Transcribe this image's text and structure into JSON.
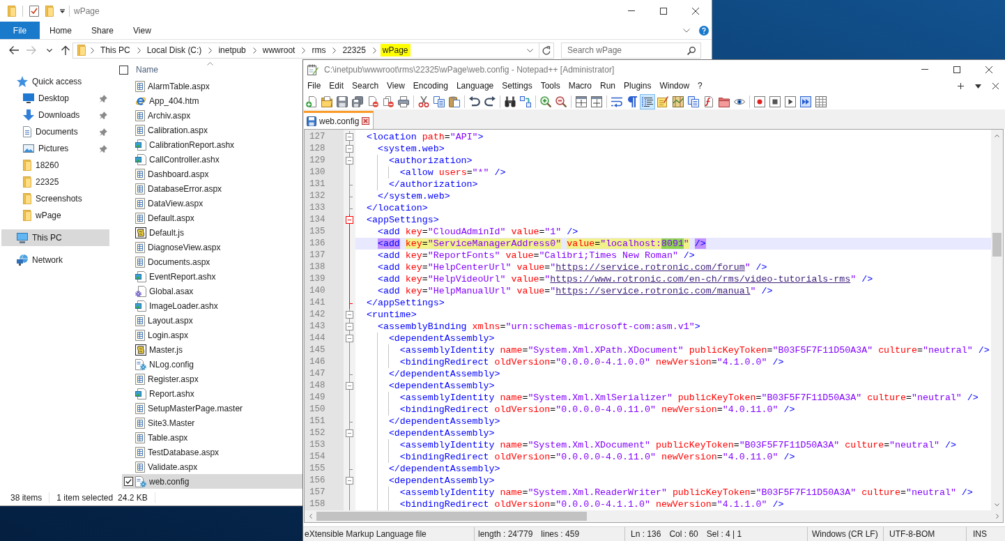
{
  "explorer": {
    "title": "wPage",
    "ribbon_tabs": [
      {
        "label": "File",
        "kind": "menu"
      },
      {
        "label": "Home",
        "kind": "tab"
      },
      {
        "label": "Share",
        "kind": "tab"
      },
      {
        "label": "View",
        "kind": "tab"
      }
    ],
    "navigation_buttons": [
      {
        "kind": "back",
        "disabled": false
      },
      {
        "kind": "forward",
        "disabled": true
      },
      {
        "kind": "recent",
        "disabled": false
      },
      {
        "kind": "up",
        "disabled": false
      }
    ],
    "breadcrumbs": [
      {
        "label": "This PC",
        "highlighted": false
      },
      {
        "label": "Local Disk (C:)",
        "highlighted": false
      },
      {
        "label": "inetpub",
        "highlighted": false
      },
      {
        "label": "wwwroot",
        "highlighted": false
      },
      {
        "label": "rms",
        "highlighted": false
      },
      {
        "label": "22325",
        "highlighted": false
      },
      {
        "label": "wPage",
        "highlighted": true
      }
    ],
    "search": {
      "placeholder": "Search wPage"
    },
    "navigation": [
      {
        "label": "Quick access",
        "kind": "star",
        "selected": false,
        "children": [
          {
            "label": "Desktop",
            "kind": "desktop",
            "selected": false,
            "pinned": true
          },
          {
            "label": "Downloads",
            "kind": "downloads",
            "selected": false,
            "pinned": true
          },
          {
            "label": "Documents",
            "kind": "documents",
            "selected": false,
            "pinned": true
          },
          {
            "label": "Pictures",
            "kind": "pictures",
            "selected": false,
            "pinned": true
          },
          {
            "label": "18260",
            "kind": "folder",
            "selected": false,
            "pinned": false
          },
          {
            "label": "22325",
            "kind": "folder",
            "selected": false,
            "pinned": false
          },
          {
            "label": "Screenshots",
            "kind": "folder",
            "selected": false,
            "pinned": false
          },
          {
            "label": "wPage",
            "kind": "folder",
            "selected": false,
            "pinned": false
          }
        ]
      },
      {
        "label": "This PC",
        "kind": "computer",
        "selected": true
      },
      {
        "label": "Network",
        "kind": "network",
        "selected": false
      }
    ],
    "select_all": {
      "checked": false
    },
    "column": {
      "label": "Name",
      "sort_ascending": true
    },
    "files": [
      {
        "name": "AlarmTable.aspx",
        "kind": "page",
        "selected": false
      },
      {
        "name": "App_404.htm",
        "kind": "web",
        "selected": false
      },
      {
        "name": "Archiv.aspx",
        "kind": "page",
        "selected": false
      },
      {
        "name": "Calibration.aspx",
        "kind": "page",
        "selected": false
      },
      {
        "name": "CalibrationReport.ashx",
        "kind": "handler",
        "selected": false
      },
      {
        "name": "CallController.ashx",
        "kind": "handler",
        "selected": false
      },
      {
        "name": "Dashboard.aspx",
        "kind": "page",
        "selected": false
      },
      {
        "name": "DatabaseError.aspx",
        "kind": "page",
        "selected": false
      },
      {
        "name": "DataView.aspx",
        "kind": "page",
        "selected": false
      },
      {
        "name": "Default.aspx",
        "kind": "page",
        "selected": false
      },
      {
        "name": "Default.js",
        "kind": "script",
        "selected": false
      },
      {
        "name": "DiagnoseView.aspx",
        "kind": "page",
        "selected": false
      },
      {
        "name": "Documents.aspx",
        "kind": "page",
        "selected": false
      },
      {
        "name": "EventReport.ashx",
        "kind": "handler",
        "selected": false
      },
      {
        "name": "Global.asax",
        "kind": "app",
        "selected": false
      },
      {
        "name": "ImageLoader.ashx",
        "kind": "handler",
        "selected": false
      },
      {
        "name": "Layout.aspx",
        "kind": "page",
        "selected": false
      },
      {
        "name": "Login.aspx",
        "kind": "page",
        "selected": false
      },
      {
        "name": "Master.js",
        "kind": "script",
        "selected": false
      },
      {
        "name": "NLog.config",
        "kind": "config",
        "selected": false
      },
      {
        "name": "Register.aspx",
        "kind": "page",
        "selected": false
      },
      {
        "name": "Report.ashx",
        "kind": "handler",
        "selected": false
      },
      {
        "name": "SetupMasterPage.master",
        "kind": "page",
        "selected": false
      },
      {
        "name": "Site3.Master",
        "kind": "page",
        "selected": false
      },
      {
        "name": "Table.aspx",
        "kind": "page",
        "selected": false
      },
      {
        "name": "TestDatabase.aspx",
        "kind": "page",
        "selected": false
      },
      {
        "name": "Validate.aspx",
        "kind": "page",
        "selected": false
      },
      {
        "name": "web.config",
        "kind": "config",
        "selected": true
      }
    ],
    "status": {
      "count": "38 items",
      "selection": "1 item selected",
      "size": "24.2 KB"
    }
  },
  "notepad": {
    "title": "C:\\inetpub\\wwwroot\\rms\\22325\\wPage\\web.config - Notepad++ [Administrator]",
    "menu": [
      "File",
      "Edit",
      "Search",
      "View",
      "Encoding",
      "Language",
      "Settings",
      "Tools",
      "Macro",
      "Run",
      "Plugins",
      "Window",
      "?"
    ],
    "toolbar": [
      [
        {
          "kind": "new",
          "pressed": false
        },
        {
          "kind": "open",
          "pressed": false
        },
        {
          "kind": "save",
          "pressed": false
        },
        {
          "kind": "saveall",
          "pressed": false
        },
        {
          "kind": "close",
          "pressed": false
        },
        {
          "kind": "closeall",
          "pressed": false
        },
        {
          "kind": "print",
          "pressed": false
        }
      ],
      [
        {
          "kind": "cut",
          "pressed": false
        },
        {
          "kind": "copy",
          "pressed": false
        },
        {
          "kind": "paste",
          "pressed": false
        }
      ],
      [
        {
          "kind": "undo",
          "pressed": false
        },
        {
          "kind": "redo",
          "pressed": false
        }
      ],
      [
        {
          "kind": "find",
          "pressed": false
        },
        {
          "kind": "replace",
          "pressed": false
        }
      ],
      [
        {
          "kind": "zoomin",
          "pressed": false
        },
        {
          "kind": "zoomout",
          "pressed": false
        }
      ],
      [
        {
          "kind": "syncv",
          "pressed": false
        },
        {
          "kind": "synch",
          "pressed": false
        }
      ],
      [
        {
          "kind": "wrap",
          "pressed": false
        },
        {
          "kind": "pilcrow",
          "pressed": false
        },
        {
          "kind": "indent",
          "pressed": true
        },
        {
          "kind": "note",
          "pressed": false
        },
        {
          "kind": "map",
          "pressed": false
        },
        {
          "kind": "doclist",
          "pressed": false
        },
        {
          "kind": "function",
          "pressed": false
        },
        {
          "kind": "workspace",
          "pressed": false
        },
        {
          "kind": "eye",
          "pressed": false
        }
      ],
      [
        {
          "kind": "record",
          "pressed": false
        },
        {
          "kind": "stop",
          "pressed": false
        },
        {
          "kind": "play",
          "pressed": false
        },
        {
          "kind": "playmany",
          "pressed": false
        },
        {
          "kind": "macrosave",
          "pressed": false
        }
      ]
    ],
    "tabs": [
      {
        "label": "web.config",
        "selected": true
      }
    ],
    "lines": [
      {
        "number": "127",
        "fold": {
          "kind": "box",
          "active": false
        },
        "current": false,
        "tokens": [
          {
            "kind": "tag",
            "text": "  <location"
          },
          {
            "kind": "attr",
            "text": " path"
          },
          {
            "kind": "eq",
            "text": "="
          },
          {
            "kind": "value",
            "text": "\"API\""
          },
          {
            "kind": "tag",
            "text": ">"
          }
        ]
      },
      {
        "number": "128",
        "fold": {
          "kind": "box",
          "active": false
        },
        "current": false,
        "tokens": [
          {
            "kind": "tag",
            "text": "    <system.web>"
          }
        ]
      },
      {
        "number": "129",
        "fold": {
          "kind": "box",
          "active": false
        },
        "current": false,
        "tokens": [
          {
            "kind": "tag",
            "text": "      <authorization>"
          }
        ]
      },
      {
        "number": "130",
        "fold": {
          "kind": "line",
          "active": false
        },
        "current": false,
        "tokens": [
          {
            "kind": "tag",
            "text": "        <allow"
          },
          {
            "kind": "attr",
            "text": " users"
          },
          {
            "kind": "eq",
            "text": "="
          },
          {
            "kind": "value",
            "text": "\"*\""
          },
          {
            "kind": "tag",
            "text": " />"
          }
        ]
      },
      {
        "number": "131",
        "fold": {
          "kind": "end",
          "active": false
        },
        "current": false,
        "tokens": [
          {
            "kind": "tag",
            "text": "      </authorization>"
          }
        ]
      },
      {
        "number": "132",
        "fold": {
          "kind": "end",
          "active": false
        },
        "current": false,
        "tokens": [
          {
            "kind": "tag",
            "text": "    </system.web>"
          }
        ]
      },
      {
        "number": "133",
        "fold": {
          "kind": "end",
          "active": false
        },
        "current": false,
        "tokens": [
          {
            "kind": "tag",
            "text": "  </location>"
          }
        ]
      },
      {
        "number": "134",
        "fold": {
          "kind": "box",
          "active": true
        },
        "current": false,
        "tokens": [
          {
            "kind": "tag",
            "text": "  <appSettings>"
          }
        ]
      },
      {
        "number": "135",
        "fold": {
          "kind": "line",
          "active": true
        },
        "current": false,
        "tokens": [
          {
            "kind": "tag",
            "text": "    <add"
          },
          {
            "kind": "attr",
            "text": " key"
          },
          {
            "kind": "eq",
            "text": "="
          },
          {
            "kind": "value",
            "text": "\"CloudAdminId\""
          },
          {
            "kind": "attr",
            "text": " value"
          },
          {
            "kind": "eq",
            "text": "="
          },
          {
            "kind": "value",
            "text": "\"1\""
          },
          {
            "kind": "tag",
            "text": " />"
          }
        ]
      },
      {
        "number": "136",
        "fold": {
          "kind": "line",
          "active": true
        },
        "current": true,
        "tokens": [
          {
            "kind": "tag",
            "text": "    <add",
            "highlighted": true,
            "selected": false
          },
          {
            "kind": "attr",
            "text": " key",
            "highlighted": true,
            "selected": false
          },
          {
            "kind": "eq",
            "text": "=",
            "highlighted": true,
            "selected": false
          },
          {
            "kind": "value",
            "text": "\"ServiceManagerAddress0\"",
            "highlighted": true,
            "selected": false
          },
          {
            "kind": "attr",
            "text": " value",
            "highlighted": true,
            "selected": false
          },
          {
            "kind": "eq",
            "text": "=",
            "highlighted": true,
            "selected": false
          },
          {
            "kind": "value",
            "text": "\"localhost:",
            "highlighted": true,
            "selected": false
          },
          {
            "kind": "value",
            "text": "8091",
            "highlighted": false,
            "selected": true
          },
          {
            "kind": "value",
            "text": "\"",
            "highlighted": true,
            "selected": false
          },
          {
            "kind": "tag",
            "text": " />",
            "highlighted": true,
            "selected": false
          }
        ]
      },
      {
        "number": "137",
        "fold": {
          "kind": "line",
          "active": true
        },
        "current": false,
        "tokens": [
          {
            "kind": "tag",
            "text": "    <add"
          },
          {
            "kind": "attr",
            "text": " key"
          },
          {
            "kind": "eq",
            "text": "="
          },
          {
            "kind": "value",
            "text": "\"ReportFonts\""
          },
          {
            "kind": "attr",
            "text": " value"
          },
          {
            "kind": "eq",
            "text": "="
          },
          {
            "kind": "value",
            "text": "\"Calibri;Times New Roman\""
          },
          {
            "kind": "tag",
            "text": " />"
          }
        ]
      },
      {
        "number": "138",
        "fold": {
          "kind": "line",
          "active": true
        },
        "current": false,
        "tokens": [
          {
            "kind": "tag",
            "text": "    <add"
          },
          {
            "kind": "attr",
            "text": " key"
          },
          {
            "kind": "eq",
            "text": "="
          },
          {
            "kind": "value",
            "text": "\"HelpCenterUrl\""
          },
          {
            "kind": "attr",
            "text": " value"
          },
          {
            "kind": "eq",
            "text": "="
          },
          {
            "kind": "value",
            "text": "\""
          },
          {
            "kind": "link",
            "text": "https://service.rotronic.com/forum"
          },
          {
            "kind": "value",
            "text": "\""
          },
          {
            "kind": "tag",
            "text": " />"
          }
        ]
      },
      {
        "number": "139",
        "fold": {
          "kind": "line",
          "active": true
        },
        "current": false,
        "tokens": [
          {
            "kind": "tag",
            "text": "    <add"
          },
          {
            "kind": "attr",
            "text": " key"
          },
          {
            "kind": "eq",
            "text": "="
          },
          {
            "kind": "value",
            "text": "\"HelpVideoUrl\""
          },
          {
            "kind": "attr",
            "text": " value"
          },
          {
            "kind": "eq",
            "text": "="
          },
          {
            "kind": "value",
            "text": "\""
          },
          {
            "kind": "link",
            "text": "https://www.rotronic.com/en-ch/rms/video-tutorials-rms"
          },
          {
            "kind": "value",
            "text": "\""
          },
          {
            "kind": "tag",
            "text": " />"
          }
        ]
      },
      {
        "number": "140",
        "fold": {
          "kind": "line",
          "active": true
        },
        "current": false,
        "tokens": [
          {
            "kind": "tag",
            "text": "    <add"
          },
          {
            "kind": "attr",
            "text": " key"
          },
          {
            "kind": "eq",
            "text": "="
          },
          {
            "kind": "value",
            "text": "\"HelpManualUrl\""
          },
          {
            "kind": "attr",
            "text": " value"
          },
          {
            "kind": "eq",
            "text": "="
          },
          {
            "kind": "value",
            "text": "\""
          },
          {
            "kind": "link",
            "text": "https://service.rotronic.com/manual"
          },
          {
            "kind": "value",
            "text": "\""
          },
          {
            "kind": "tag",
            "text": " />"
          }
        ]
      },
      {
        "number": "141",
        "fold": {
          "kind": "end",
          "active": true
        },
        "current": false,
        "tokens": [
          {
            "kind": "tag",
            "text": "  </appSettings>"
          }
        ]
      },
      {
        "number": "142",
        "fold": {
          "kind": "box",
          "active": false
        },
        "current": false,
        "tokens": [
          {
            "kind": "tag",
            "text": "  <runtime>"
          }
        ]
      },
      {
        "number": "143",
        "fold": {
          "kind": "box",
          "active": false
        },
        "current": false,
        "tokens": [
          {
            "kind": "tag",
            "text": "    <assemblyBinding"
          },
          {
            "kind": "attr",
            "text": " xmlns"
          },
          {
            "kind": "eq",
            "text": "="
          },
          {
            "kind": "value",
            "text": "\"urn:schemas-microsoft-com:asm.v1\""
          },
          {
            "kind": "tag",
            "text": ">"
          }
        ]
      },
      {
        "number": "144",
        "fold": {
          "kind": "box",
          "active": false
        },
        "current": false,
        "tokens": [
          {
            "kind": "tag",
            "text": "      <dependentAssembly>"
          }
        ]
      },
      {
        "number": "145",
        "fold": {
          "kind": "line",
          "active": false
        },
        "current": false,
        "tokens": [
          {
            "kind": "tag",
            "text": "        <assemblyIdentity"
          },
          {
            "kind": "attr",
            "text": " name"
          },
          {
            "kind": "eq",
            "text": "="
          },
          {
            "kind": "value",
            "text": "\"System.Xml.XPath.XDocument\""
          },
          {
            "kind": "attr",
            "text": " publicKeyToken"
          },
          {
            "kind": "eq",
            "text": "="
          },
          {
            "kind": "value",
            "text": "\"B03F5F7F11D50A3A\""
          },
          {
            "kind": "attr",
            "text": " culture"
          },
          {
            "kind": "eq",
            "text": "="
          },
          {
            "kind": "value",
            "text": "\"neutral\""
          },
          {
            "kind": "tag",
            "text": " />"
          }
        ]
      },
      {
        "number": "146",
        "fold": {
          "kind": "line",
          "active": false
        },
        "current": false,
        "tokens": [
          {
            "kind": "tag",
            "text": "        <bindingRedirect"
          },
          {
            "kind": "attr",
            "text": " oldVersion"
          },
          {
            "kind": "eq",
            "text": "="
          },
          {
            "kind": "value",
            "text": "\"0.0.0.0-4.1.0.0\""
          },
          {
            "kind": "attr",
            "text": " newVersion"
          },
          {
            "kind": "eq",
            "text": "="
          },
          {
            "kind": "value",
            "text": "\"4.1.0.0\""
          },
          {
            "kind": "tag",
            "text": " />"
          }
        ]
      },
      {
        "number": "147",
        "fold": {
          "kind": "end",
          "active": false
        },
        "current": false,
        "tokens": [
          {
            "kind": "tag",
            "text": "      </dependentAssembly>"
          }
        ]
      },
      {
        "number": "148",
        "fold": {
          "kind": "box",
          "active": false
        },
        "current": false,
        "tokens": [
          {
            "kind": "tag",
            "text": "      <dependentAssembly>"
          }
        ]
      },
      {
        "number": "149",
        "fold": {
          "kind": "line",
          "active": false
        },
        "current": false,
        "tokens": [
          {
            "kind": "tag",
            "text": "        <assemblyIdentity"
          },
          {
            "kind": "attr",
            "text": " name"
          },
          {
            "kind": "eq",
            "text": "="
          },
          {
            "kind": "value",
            "text": "\"System.Xml.XmlSerializer\""
          },
          {
            "kind": "attr",
            "text": " publicKeyToken"
          },
          {
            "kind": "eq",
            "text": "="
          },
          {
            "kind": "value",
            "text": "\"B03F5F7F11D50A3A\""
          },
          {
            "kind": "attr",
            "text": " culture"
          },
          {
            "kind": "eq",
            "text": "="
          },
          {
            "kind": "value",
            "text": "\"neutral\""
          },
          {
            "kind": "tag",
            "text": " />"
          }
        ]
      },
      {
        "number": "150",
        "fold": {
          "kind": "line",
          "active": false
        },
        "current": false,
        "tokens": [
          {
            "kind": "tag",
            "text": "        <bindingRedirect"
          },
          {
            "kind": "attr",
            "text": " oldVersion"
          },
          {
            "kind": "eq",
            "text": "="
          },
          {
            "kind": "value",
            "text": "\"0.0.0.0-4.0.11.0\""
          },
          {
            "kind": "attr",
            "text": " newVersion"
          },
          {
            "kind": "eq",
            "text": "="
          },
          {
            "kind": "value",
            "text": "\"4.0.11.0\""
          },
          {
            "kind": "tag",
            "text": " />"
          }
        ]
      },
      {
        "number": "151",
        "fold": {
          "kind": "end",
          "active": false
        },
        "current": false,
        "tokens": [
          {
            "kind": "tag",
            "text": "      </dependentAssembly>"
          }
        ]
      },
      {
        "number": "152",
        "fold": {
          "kind": "box",
          "active": false
        },
        "current": false,
        "tokens": [
          {
            "kind": "tag",
            "text": "      <dependentAssembly>"
          }
        ]
      },
      {
        "number": "153",
        "fold": {
          "kind": "line",
          "active": false
        },
        "current": false,
        "tokens": [
          {
            "kind": "tag",
            "text": "        <assemblyIdentity"
          },
          {
            "kind": "attr",
            "text": " name"
          },
          {
            "kind": "eq",
            "text": "="
          },
          {
            "kind": "value",
            "text": "\"System.Xml.XDocument\""
          },
          {
            "kind": "attr",
            "text": " publicKeyToken"
          },
          {
            "kind": "eq",
            "text": "="
          },
          {
            "kind": "value",
            "text": "\"B03F5F7F11D50A3A\""
          },
          {
            "kind": "attr",
            "text": " culture"
          },
          {
            "kind": "eq",
            "text": "="
          },
          {
            "kind": "value",
            "text": "\"neutral\""
          },
          {
            "kind": "tag",
            "text": " />"
          }
        ]
      },
      {
        "number": "154",
        "fold": {
          "kind": "line",
          "active": false
        },
        "current": false,
        "tokens": [
          {
            "kind": "tag",
            "text": "        <bindingRedirect"
          },
          {
            "kind": "attr",
            "text": " oldVersion"
          },
          {
            "kind": "eq",
            "text": "="
          },
          {
            "kind": "value",
            "text": "\"0.0.0.0-4.0.11.0\""
          },
          {
            "kind": "attr",
            "text": " newVersion"
          },
          {
            "kind": "eq",
            "text": "="
          },
          {
            "kind": "value",
            "text": "\"4.0.11.0\""
          },
          {
            "kind": "tag",
            "text": " />"
          }
        ]
      },
      {
        "number": "155",
        "fold": {
          "kind": "end",
          "active": false
        },
        "current": false,
        "tokens": [
          {
            "kind": "tag",
            "text": "      </dependentAssembly>"
          }
        ]
      },
      {
        "number": "156",
        "fold": {
          "kind": "box",
          "active": false
        },
        "current": false,
        "tokens": [
          {
            "kind": "tag",
            "text": "      <dependentAssembly>"
          }
        ]
      },
      {
        "number": "157",
        "fold": {
          "kind": "line",
          "active": false
        },
        "current": false,
        "tokens": [
          {
            "kind": "tag",
            "text": "        <assemblyIdentity"
          },
          {
            "kind": "attr",
            "text": " name"
          },
          {
            "kind": "eq",
            "text": "="
          },
          {
            "kind": "value",
            "text": "\"System.Xml.ReaderWriter\""
          },
          {
            "kind": "attr",
            "text": " publicKeyToken"
          },
          {
            "kind": "eq",
            "text": "="
          },
          {
            "kind": "value",
            "text": "\"B03F5F7F11D50A3A\""
          },
          {
            "kind": "attr",
            "text": " culture"
          },
          {
            "kind": "eq",
            "text": "="
          },
          {
            "kind": "value",
            "text": "\"neutral\""
          },
          {
            "kind": "tag",
            "text": " />"
          }
        ]
      },
      {
        "number": "158",
        "fold": {
          "kind": "line",
          "active": false
        },
        "current": false,
        "tokens": [
          {
            "kind": "tag",
            "text": "        <bindingRedirect"
          },
          {
            "kind": "attr",
            "text": " oldVersion"
          },
          {
            "kind": "eq",
            "text": "="
          },
          {
            "kind": "value",
            "text": "\"0.0.0.0-4.1.1.0\""
          },
          {
            "kind": "attr",
            "text": " newVersion"
          },
          {
            "kind": "eq",
            "text": "="
          },
          {
            "kind": "value",
            "text": "\"4.1.1.0\""
          },
          {
            "kind": "tag",
            "text": " />"
          }
        ]
      }
    ],
    "status": {
      "file_type": "eXtensible Markup Language file",
      "length": "length : 24'779",
      "lines": "lines : 459",
      "line": "Ln : 136",
      "column": "Col : 60",
      "selection": "Sel : 4 | 1",
      "eol": "Windows (CR LF)",
      "encoding": "UTF-8-BOM",
      "mode": "INS"
    }
  }
}
